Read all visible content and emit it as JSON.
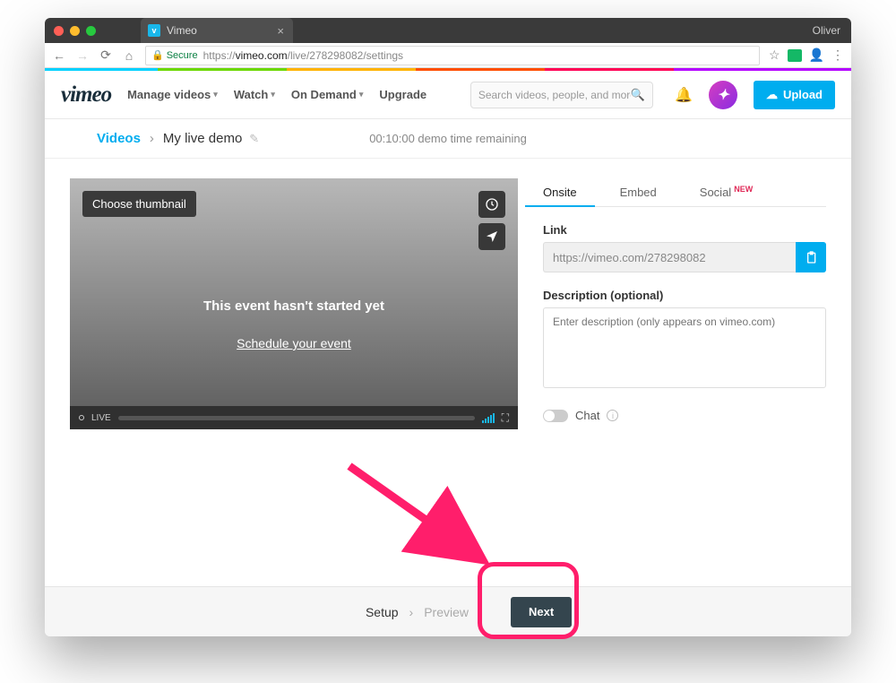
{
  "browser": {
    "tab_title": "Vimeo",
    "user": "Oliver",
    "secure_label": "Secure",
    "url_prefix": "https://",
    "url_host": "vimeo.com",
    "url_path": "/live/278298082/settings"
  },
  "header": {
    "logo": "vimeo",
    "nav": {
      "manage": "Manage videos",
      "watch": "Watch",
      "ondemand": "On Demand",
      "upgrade": "Upgrade"
    },
    "search_placeholder": "Search videos, people, and more",
    "upload": "Upload"
  },
  "breadcrumb": {
    "root": "Videos",
    "title": "My live demo",
    "demo_time": "00:10:00  demo time remaining"
  },
  "player": {
    "choose_thumb": "Choose thumbnail",
    "event_msg": "This event hasn't started yet",
    "schedule": "Schedule your event",
    "live_label": "LIVE"
  },
  "tabs": {
    "onsite": "Onsite",
    "embed": "Embed",
    "social": "Social",
    "new_badge": "NEW"
  },
  "form": {
    "link_label": "Link",
    "link_value": "https://vimeo.com/278298082",
    "desc_label": "Description (optional)",
    "desc_placeholder": "Enter description (only appears on vimeo.com)",
    "chat_label": "Chat"
  },
  "footer": {
    "setup": "Setup",
    "preview": "Preview",
    "next": "Next"
  }
}
